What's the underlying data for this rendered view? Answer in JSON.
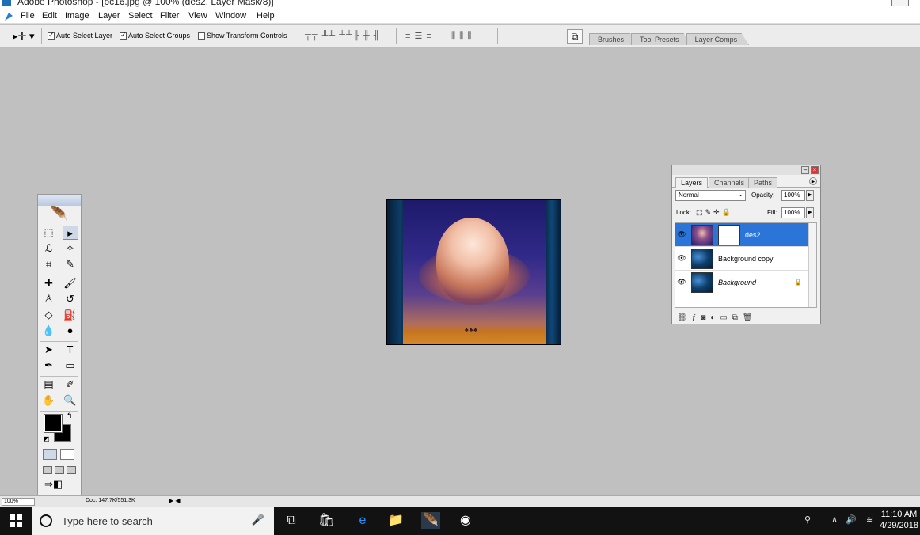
{
  "window": {
    "title": "Adobe Photoshop - [bc16.jpg @ 100% (des2, Layer Mask/8)]"
  },
  "menubar": {
    "items": [
      "File",
      "Edit",
      "Image",
      "Layer",
      "Select",
      "Filter",
      "View",
      "Window",
      "Help"
    ]
  },
  "options": {
    "auto_select_layer": "Auto Select Layer",
    "auto_select_groups": "Auto Select Groups",
    "show_transform_controls": "Show Transform Controls",
    "wells": [
      "Brushes",
      "Tool Presets",
      "Layer Comps"
    ]
  },
  "layers_panel": {
    "tabs": [
      "Layers",
      "Channels",
      "Paths"
    ],
    "blend_mode": "Normal",
    "opacity_label": "Opacity:",
    "opacity_value": "100%",
    "lock_label": "Lock:",
    "fill_label": "Fill:",
    "fill_value": "100%",
    "layers": [
      {
        "name": "des2",
        "selected": true
      },
      {
        "name": "Background copy",
        "selected": false
      },
      {
        "name": "Background",
        "selected": false
      }
    ]
  },
  "status": {
    "zoom": "100%",
    "doc_info": "Doc: 147.7K/551.3K"
  },
  "taskbar": {
    "search_placeholder": "Type here to search",
    "time": "11:10 AM",
    "date": "4/29/2018"
  },
  "colors": {
    "selected_layer": "#2b75d8",
    "taskbar": "#121212",
    "workspace": "#c0c0c0"
  }
}
